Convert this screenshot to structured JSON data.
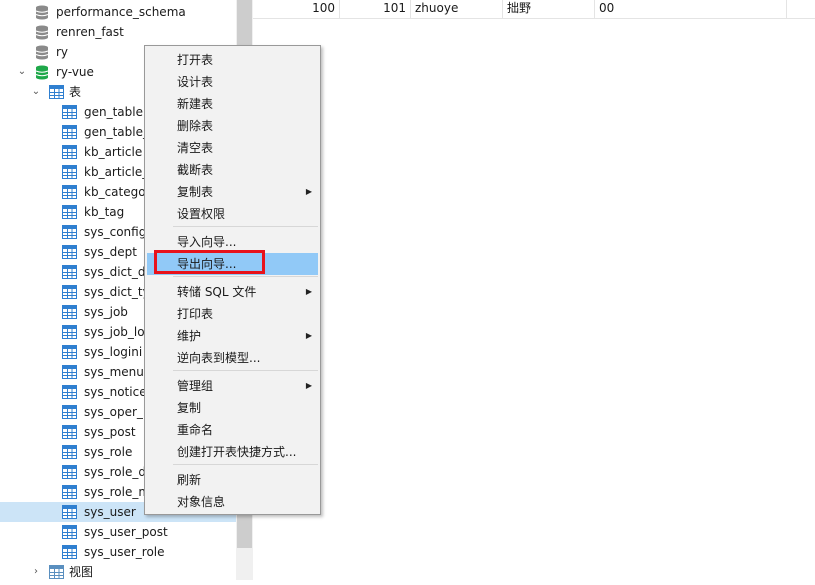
{
  "tree": {
    "items": [
      {
        "label": "performance_schema",
        "kind": "database"
      },
      {
        "label": "renren_fast",
        "kind": "database"
      },
      {
        "label": "ry",
        "kind": "database"
      },
      {
        "label": "ry-vue",
        "kind": "database-open"
      },
      {
        "label": "表",
        "kind": "tables-folder"
      },
      {
        "label": "gen_table",
        "kind": "table"
      },
      {
        "label": "gen_table_",
        "kind": "table"
      },
      {
        "label": "kb_article",
        "kind": "table"
      },
      {
        "label": "kb_article_",
        "kind": "table"
      },
      {
        "label": "kb_catego",
        "kind": "table"
      },
      {
        "label": "kb_tag",
        "kind": "table"
      },
      {
        "label": "sys_config",
        "kind": "table"
      },
      {
        "label": "sys_dept",
        "kind": "table"
      },
      {
        "label": "sys_dict_d",
        "kind": "table"
      },
      {
        "label": "sys_dict_ty",
        "kind": "table"
      },
      {
        "label": "sys_job",
        "kind": "table"
      },
      {
        "label": "sys_job_lo",
        "kind": "table"
      },
      {
        "label": "sys_logini",
        "kind": "table"
      },
      {
        "label": "sys_menu",
        "kind": "table"
      },
      {
        "label": "sys_notice",
        "kind": "table"
      },
      {
        "label": "sys_oper_l",
        "kind": "table"
      },
      {
        "label": "sys_post",
        "kind": "table"
      },
      {
        "label": "sys_role",
        "kind": "table"
      },
      {
        "label": "sys_role_d",
        "kind": "table"
      },
      {
        "label": "sys_role_m",
        "kind": "table"
      },
      {
        "label": "sys_user",
        "kind": "table",
        "selected": true
      },
      {
        "label": "sys_user_post",
        "kind": "table"
      },
      {
        "label": "sys_user_role",
        "kind": "table"
      },
      {
        "label": "视图",
        "kind": "views-folder"
      }
    ]
  },
  "grid": {
    "row": [
      "100",
      "101",
      "zhuoye",
      "拙野",
      "00"
    ]
  },
  "context_menu": {
    "items": [
      {
        "label": "打开表"
      },
      {
        "label": "设计表"
      },
      {
        "label": "新建表"
      },
      {
        "label": "删除表"
      },
      {
        "label": "清空表"
      },
      {
        "label": "截断表"
      },
      {
        "label": "复制表",
        "submenu": true
      },
      {
        "label": "设置权限"
      },
      {
        "label": "导入向导..."
      },
      {
        "label": "导出向导...",
        "hover": true
      },
      {
        "label": "转储 SQL 文件",
        "submenu": true
      },
      {
        "label": "打印表"
      },
      {
        "label": "维护",
        "submenu": true
      },
      {
        "label": "逆向表到模型..."
      },
      {
        "label": "管理组",
        "submenu": true
      },
      {
        "label": "复制"
      },
      {
        "label": "重命名"
      },
      {
        "label": "创建打开表快捷方式..."
      },
      {
        "label": "刷新"
      },
      {
        "label": "对象信息"
      }
    ]
  },
  "colors": {
    "selection": "#cce4f7",
    "menu_hover": "#91c9f7",
    "highlight_border": "#e8121a",
    "table_icon": "#2f7fd0",
    "db_icon": "#8a8a8a",
    "db_open_icon": "#1fa84a"
  }
}
